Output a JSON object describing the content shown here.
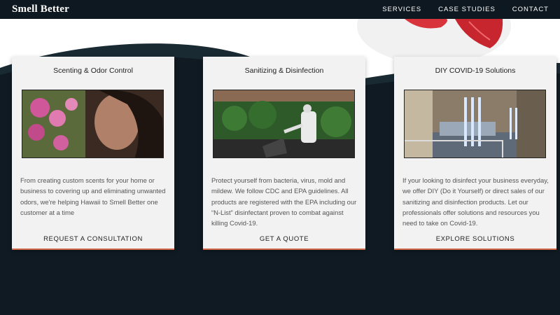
{
  "header": {
    "logo": "Smell Better",
    "nav": [
      "SERVICES",
      "CASE STUDIES",
      "CONTACT"
    ]
  },
  "cards": [
    {
      "title": "Scenting & Odor Control",
      "text": "From creating custom scents for your home or business to covering up and eliminating unwanted odors, we're helping Hawaii to Smell Better one customer at a time",
      "cta": "REQUEST A CONSULTATION"
    },
    {
      "title": "Sanitizing & Disinfection",
      "text": "Protect yourself from bacteria, virus, mold and mildew. We follow CDC and EPA guidelines. All products are registered with the EPA including our “N-List” disinfectant proven to combat against killing Covid-19.",
      "cta": "GET A QUOTE"
    },
    {
      "title": "DIY COVID-19 Solutions",
      "text": "If your looking to disinfect your business everyday, we offer DIY (Do it Yourself) or direct sales of our sanitizing and disinfection products. Let our professionals offer solutions and resources you need to take on Covid-19.",
      "cta": "EXPLORE SOLUTIONS"
    }
  ],
  "colors": {
    "background": "#0f1a22",
    "card": "#f2f2f2",
    "accent_border": "#d26a4a"
  }
}
